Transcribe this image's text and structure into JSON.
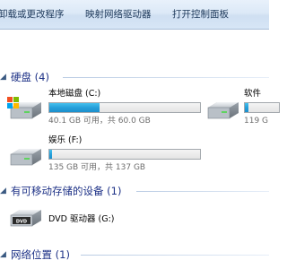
{
  "toolbar": {
    "items": [
      {
        "label": "卸载或更改程序"
      },
      {
        "label": "映射网络驱动器"
      },
      {
        "label": "打开控制面板"
      }
    ]
  },
  "groups": {
    "hard_disks": {
      "title": "硬盘 (4)",
      "drives": [
        {
          "name": "本地磁盘 (C:)",
          "info": "40.1 GB 可用，共 60.0 GB",
          "used_fraction": 0.332
        },
        {
          "name": "软件",
          "info": "119 G",
          "used_fraction": 0.1
        },
        {
          "name": "娱乐 (F:)",
          "info": "135 GB 可用，共 137 GB",
          "used_fraction": 0.015
        }
      ]
    },
    "removable": {
      "title": "有可移动存储的设备 (1)",
      "drives": [
        {
          "name": "DVD 驱动器 (G:)",
          "icon": "dvd-drive-icon"
        }
      ]
    },
    "network": {
      "title": "网络位置 (1)"
    }
  },
  "colors": {
    "group_title": "#1e3287",
    "bar_fill": "#26a0da",
    "toolbar_bg": "#dce9f7"
  }
}
